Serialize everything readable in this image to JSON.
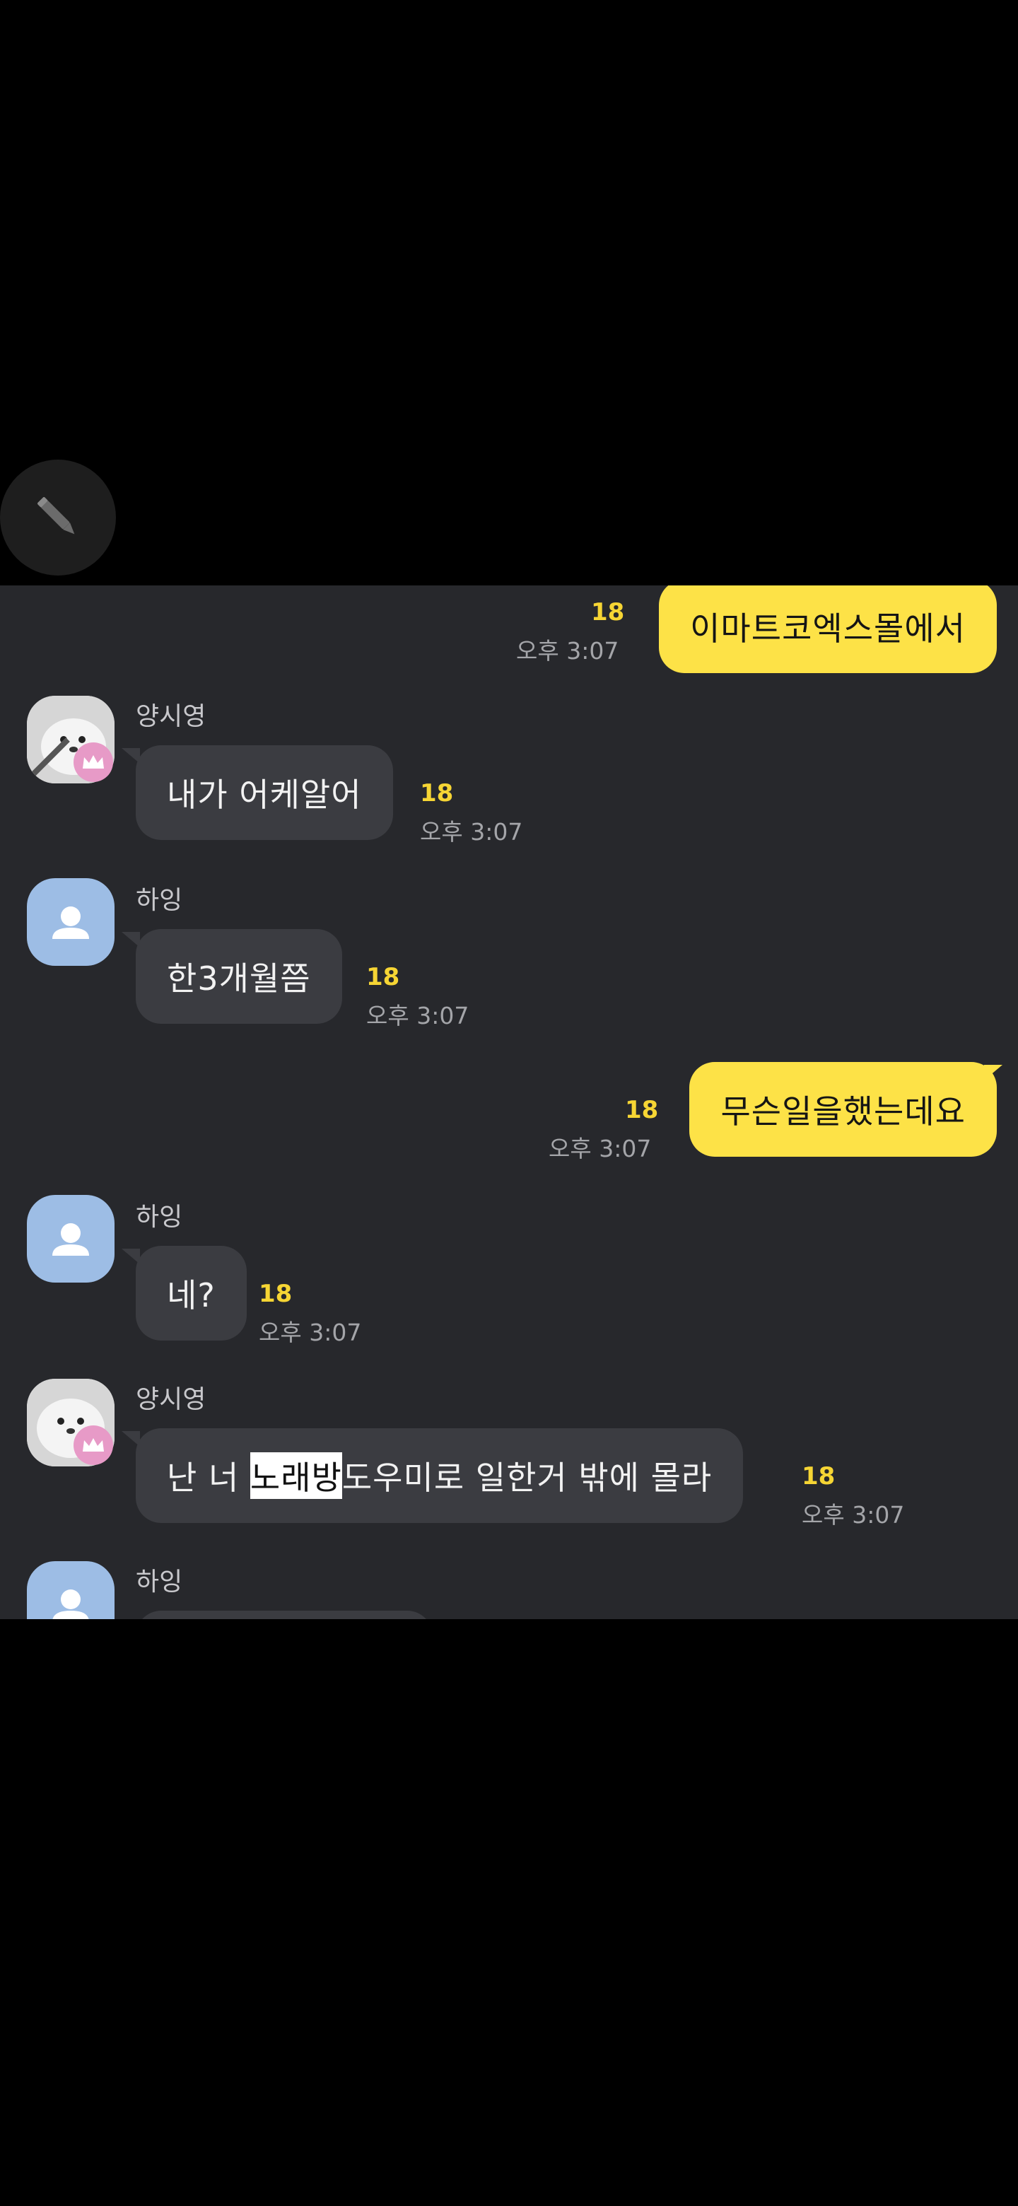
{
  "compose": {
    "icon": "pencil-icon"
  },
  "messages": [
    {
      "id": "m1",
      "direction": "outgoing",
      "text": "이마트코엑스몰에서",
      "unread": "18",
      "time": "오후 3:07"
    },
    {
      "id": "m2",
      "direction": "incoming",
      "sender": "양시영",
      "avatar": "seal-photo-avatar",
      "badge": "crown-icon",
      "text": "내가 어케알어",
      "unread": "18",
      "time": "오후 3:07"
    },
    {
      "id": "m3",
      "direction": "incoming",
      "sender": "하잉",
      "avatar": "default-profile-avatar",
      "text": "한3개월쯤",
      "unread": "18",
      "time": "오후 3:07"
    },
    {
      "id": "m4",
      "direction": "outgoing",
      "text": "무슨일을했는데요",
      "unread": "18",
      "time": "오후 3:07"
    },
    {
      "id": "m5",
      "direction": "incoming",
      "sender": "하잉",
      "avatar": "default-profile-avatar",
      "text": "네?",
      "unread": "18",
      "time": "오후 3:07"
    },
    {
      "id": "m6",
      "direction": "incoming",
      "sender": "양시영",
      "avatar": "seal-photo-avatar",
      "badge": "crown-icon",
      "text_before": "난 너 ",
      "text_highlight": "노래방",
      "text_after": "도우미로 일한거 밖에 몰라",
      "unread": "18",
      "time": "오후 3:07"
    },
    {
      "id": "m7",
      "direction": "incoming",
      "sender": "하잉",
      "avatar": "default-profile-avatar"
    }
  ],
  "colors": {
    "background": "#000000",
    "chat_background": "#27282c",
    "outgoing_bubble": "#fde247",
    "incoming_bubble": "#3b3c41",
    "unread_count": "#f6d534",
    "avatar_default": "#9dbde5",
    "badge": "#e79ac7"
  }
}
